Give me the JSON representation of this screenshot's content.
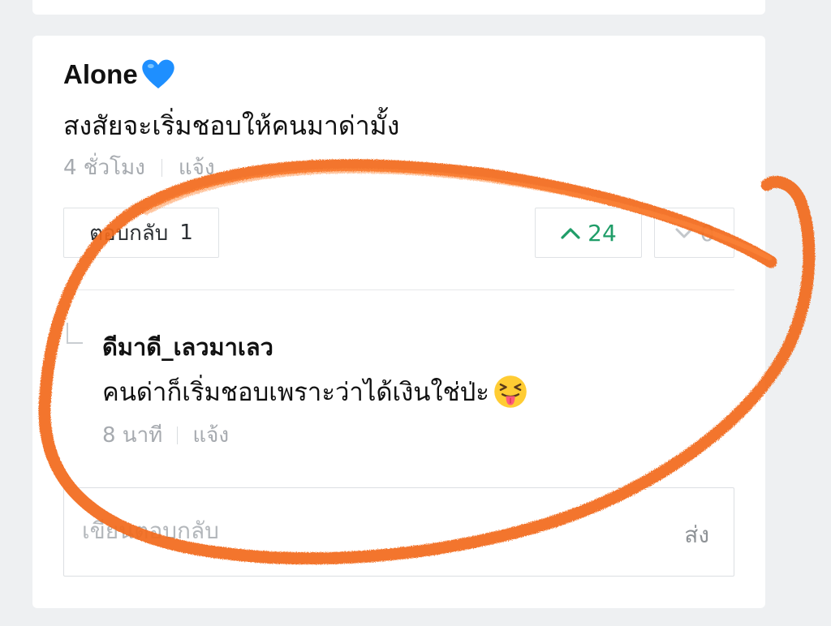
{
  "comment": {
    "author": "Alone",
    "text": "สงสัยจะเริ่มชอบให้คนมาด่ามั้ง",
    "time": "4 ชั่วโมง",
    "report_label": "แจ้ง",
    "reply_button_label": "ตอบกลับ",
    "reply_count": "1",
    "upvotes": "24",
    "downvotes": "0"
  },
  "reply": {
    "author": "ดีมาดี_เลวมาเลว",
    "text": "คนด่าก็เริ่มชอบเพราะว่าได้เงินใช่ป่ะ",
    "time": "8 นาที",
    "report_label": "แจ้ง"
  },
  "reply_box": {
    "placeholder": "เขียนตอบกลับ",
    "send_label": "ส่ง"
  },
  "colors": {
    "upvote_green": "#1f9d68",
    "annotation_orange": "#f26a1b",
    "heart_blue": "#1e8fff"
  },
  "icons": {
    "author_badge": "blue-heart-icon",
    "reply_emoji": "squinting-tongue-emoji-icon",
    "upvote": "chevron-up-icon",
    "downvote": "chevron-down-icon"
  }
}
